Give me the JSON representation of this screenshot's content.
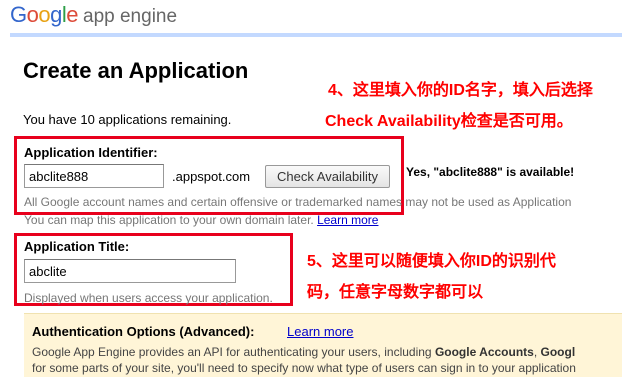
{
  "header": {
    "logo_google": "Google",
    "logo_product": "app engine"
  },
  "page": {
    "title": "Create an Application",
    "remaining": "You have 10 applications remaining."
  },
  "annotations": {
    "step4_line1": "4、这里填入你的ID名字，填入后选择",
    "step4_line2": "Check Availability检查是否可用。",
    "step5_line1": "5、这里可以随便填入你ID的识别代",
    "step5_line2": "码，任意字母数字都可以"
  },
  "identifier": {
    "label": "Application Identifier:",
    "value": "abclite888",
    "suffix": ".appspot.com",
    "check_button": "Check Availability",
    "availability": "Yes, \"abclite888\" is available!",
    "hint": "All Google account names and certain offensive or trademarked names may not be used as Application",
    "map_text": "You can map this application to your own domain later.",
    "learn_more": "Learn more"
  },
  "app_title": {
    "label": "Application Title:",
    "value": "abclite",
    "hint": "Displayed when users access your application."
  },
  "auth": {
    "title": "Authentication Options (Advanced):",
    "learn_more": "Learn more",
    "desc1_prefix": "Google App Engine provides an API for authenticating your users, including ",
    "desc1_bold1": "Google Accounts",
    "desc1_mid": ", ",
    "desc1_bold2": "Googl",
    "desc2": "for some parts of your site, you'll need to specify now what type of users can sign in to your application"
  },
  "colors": {
    "annotation": "#ff0000",
    "header_bar": "#c3d9ff",
    "auth_bg": "#fff5d7",
    "link": "#0000cc"
  }
}
